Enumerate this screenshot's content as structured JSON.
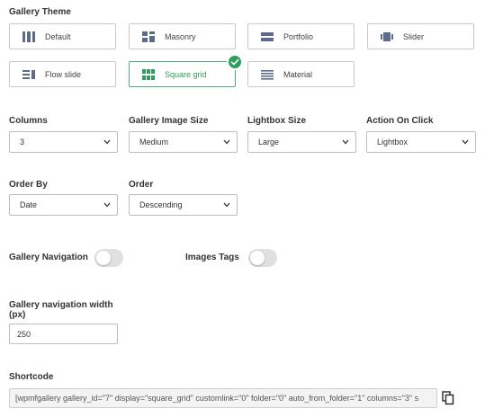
{
  "gallery_theme": {
    "title": "Gallery Theme",
    "options": [
      {
        "label": "Default",
        "icon": "default-columns-icon",
        "active": false
      },
      {
        "label": "Masonry",
        "icon": "masonry-icon",
        "active": false
      },
      {
        "label": "Portfolio",
        "icon": "portfolio-icon",
        "active": false
      },
      {
        "label": "Slider",
        "icon": "slider-icon",
        "active": false
      },
      {
        "label": "Flow slide",
        "icon": "flow-slide-icon",
        "active": false
      },
      {
        "label": "Square grid",
        "icon": "square-grid-icon",
        "active": true
      },
      {
        "label": "Material",
        "icon": "material-icon",
        "active": false
      }
    ],
    "accent_color": "#2e9e5e"
  },
  "settings": {
    "columns": {
      "label": "Columns",
      "value": "3"
    },
    "image_size": {
      "label": "Gallery Image Size",
      "value": "Medium"
    },
    "lightbox_size": {
      "label": "Lightbox Size",
      "value": "Large"
    },
    "action_on_click": {
      "label": "Action On Click",
      "value": "Lightbox"
    },
    "order_by": {
      "label": "Order By",
      "value": "Date"
    },
    "order": {
      "label": "Order",
      "value": "Descending"
    }
  },
  "toggles": {
    "gallery_navigation": {
      "label": "Gallery Navigation",
      "on": false
    },
    "images_tags": {
      "label": "Images Tags",
      "on": false
    }
  },
  "nav_width": {
    "label": "Gallery navigation width (px)",
    "value": "250"
  },
  "shortcode": {
    "label": "Shortcode",
    "value": "[wpmfgallery gallery_id=\"7\" display=\"square_grid\" customlink=\"0\" folder=\"0\" auto_from_folder=\"1\" columns=\"3\" s",
    "copy_icon": "copy-icon"
  }
}
